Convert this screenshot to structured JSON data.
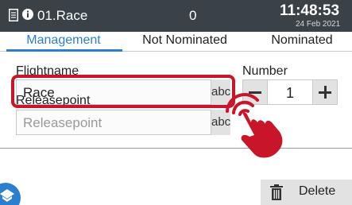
{
  "title_bar": {
    "document_icon": "document-icon",
    "info_icon": "info-circle-icon",
    "title": "01.Race",
    "count": "0",
    "time": "11:48:53",
    "date": "24 Feb 2021",
    "background": "#3a4147"
  },
  "tabs": [
    {
      "label": "Management",
      "active": true
    },
    {
      "label": "Not Nominated",
      "active": false
    },
    {
      "label": "Nominated",
      "active": false
    }
  ],
  "form": {
    "flightname": {
      "label": "Flightname",
      "value": "Race",
      "keyboard_label": "abc"
    },
    "number": {
      "label": "Number",
      "value": "1",
      "minus_icon": "minus-icon",
      "plus_icon": "plus-icon"
    },
    "releasepoint": {
      "label": "Releasepoint",
      "placeholder": "Releasepoint",
      "value": "",
      "keyboard_label": "abc"
    }
  },
  "actions": {
    "delete_label": "Delete",
    "delete_icon": "trash-icon",
    "fab_icon": "pigeon-icon"
  },
  "overlay": {
    "highlight_color": "#c9152a",
    "pointer_icon": "tap-hand-icon"
  },
  "colors": {
    "accent": "#2b7fd1",
    "highlight": "#c9152a"
  }
}
